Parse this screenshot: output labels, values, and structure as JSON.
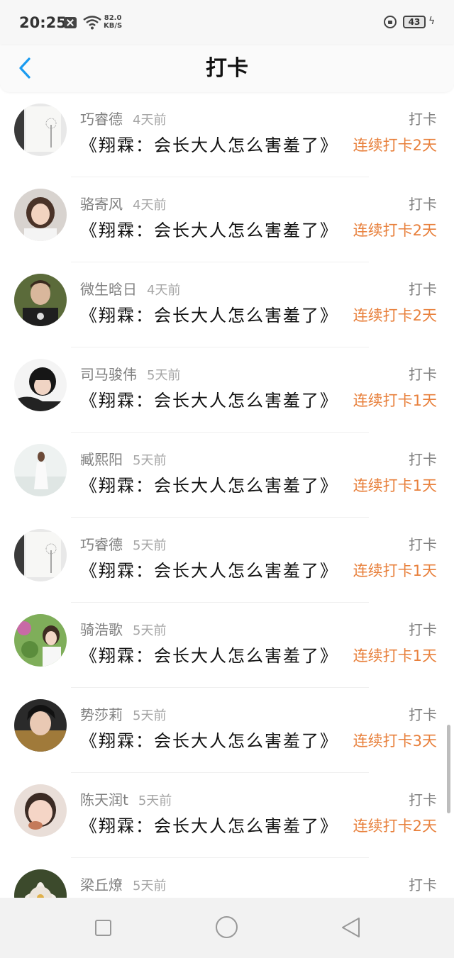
{
  "status_bar": {
    "time": "20:25",
    "net_speed_value": "82.0",
    "net_speed_unit": "KB/S",
    "battery": "43"
  },
  "header": {
    "title": "打卡"
  },
  "colors": {
    "accent": "#1a9bf0",
    "streak": "#e8803c"
  },
  "items": [
    {
      "name": "巧睿德",
      "time": "4天前",
      "type": "打卡",
      "content": "《翔霖：会长大人怎么害羞了》",
      "streak": "连续打卡2天"
    },
    {
      "name": "骆寄风",
      "time": "4天前",
      "type": "打卡",
      "content": "《翔霖：会长大人怎么害羞了》",
      "streak": "连续打卡2天"
    },
    {
      "name": "微生晗日",
      "time": "4天前",
      "type": "打卡",
      "content": "《翔霖：会长大人怎么害羞了》",
      "streak": "连续打卡2天"
    },
    {
      "name": "司马骏伟",
      "time": "5天前",
      "type": "打卡",
      "content": "《翔霖：会长大人怎么害羞了》",
      "streak": "连续打卡1天"
    },
    {
      "name": "臧熙阳",
      "time": "5天前",
      "type": "打卡",
      "content": "《翔霖：会长大人怎么害羞了》",
      "streak": "连续打卡1天"
    },
    {
      "name": "巧睿德",
      "time": "5天前",
      "type": "打卡",
      "content": "《翔霖：会长大人怎么害羞了》",
      "streak": "连续打卡1天"
    },
    {
      "name": "骑浩歌",
      "time": "5天前",
      "type": "打卡",
      "content": "《翔霖：会长大人怎么害羞了》",
      "streak": "连续打卡1天"
    },
    {
      "name": "势莎莉",
      "time": "5天前",
      "type": "打卡",
      "content": "《翔霖：会长大人怎么害羞了》",
      "streak": "连续打卡3天"
    },
    {
      "name": "陈天润t",
      "time": "5天前",
      "type": "打卡",
      "content": "《翔霖：会长大人怎么害羞了》",
      "streak": "连续打卡2天"
    },
    {
      "name": "梁丘燎",
      "time": "5天前",
      "type": "打卡",
      "content": "",
      "streak": ""
    }
  ]
}
